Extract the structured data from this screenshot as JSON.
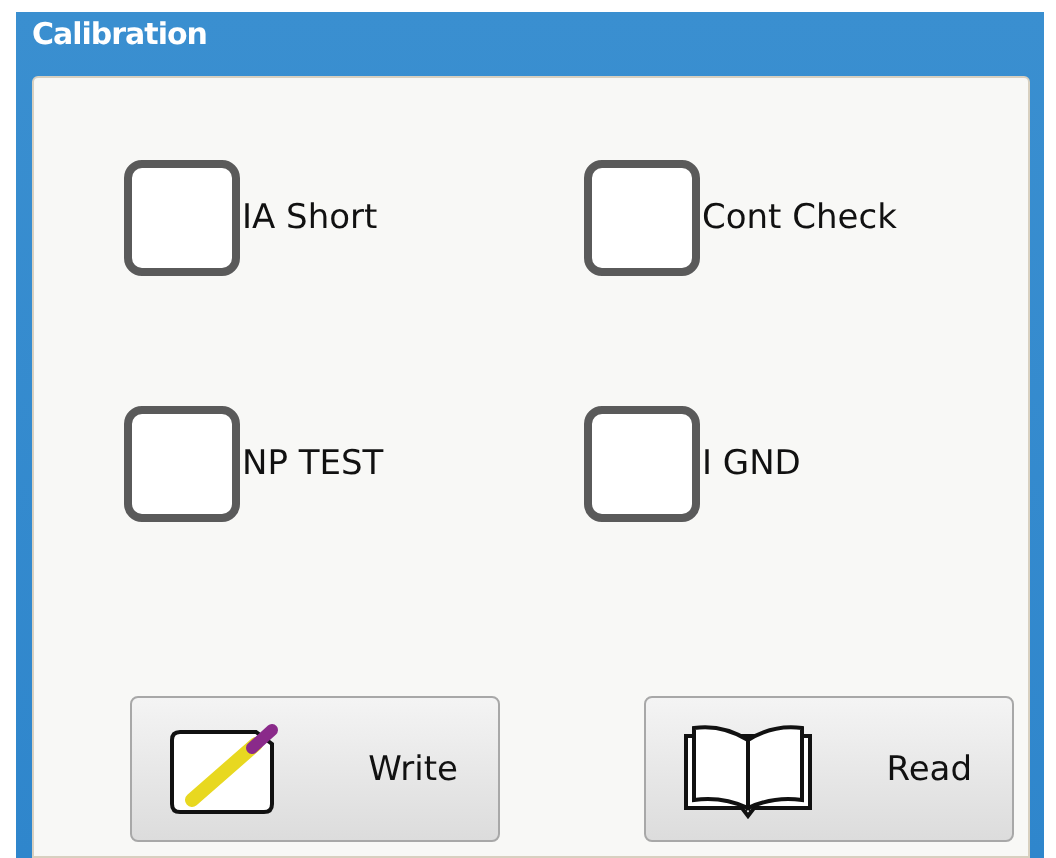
{
  "window": {
    "title": "Calibration"
  },
  "checkboxes": [
    {
      "label": "IA Short",
      "checked": false
    },
    {
      "label": "Cont Check",
      "checked": false
    },
    {
      "label": "NP TEST",
      "checked": false
    },
    {
      "label": "I GND",
      "checked": false
    }
  ],
  "buttons": [
    {
      "label": "Write",
      "kind": "write"
    },
    {
      "label": "Read",
      "kind": "read"
    }
  ]
}
